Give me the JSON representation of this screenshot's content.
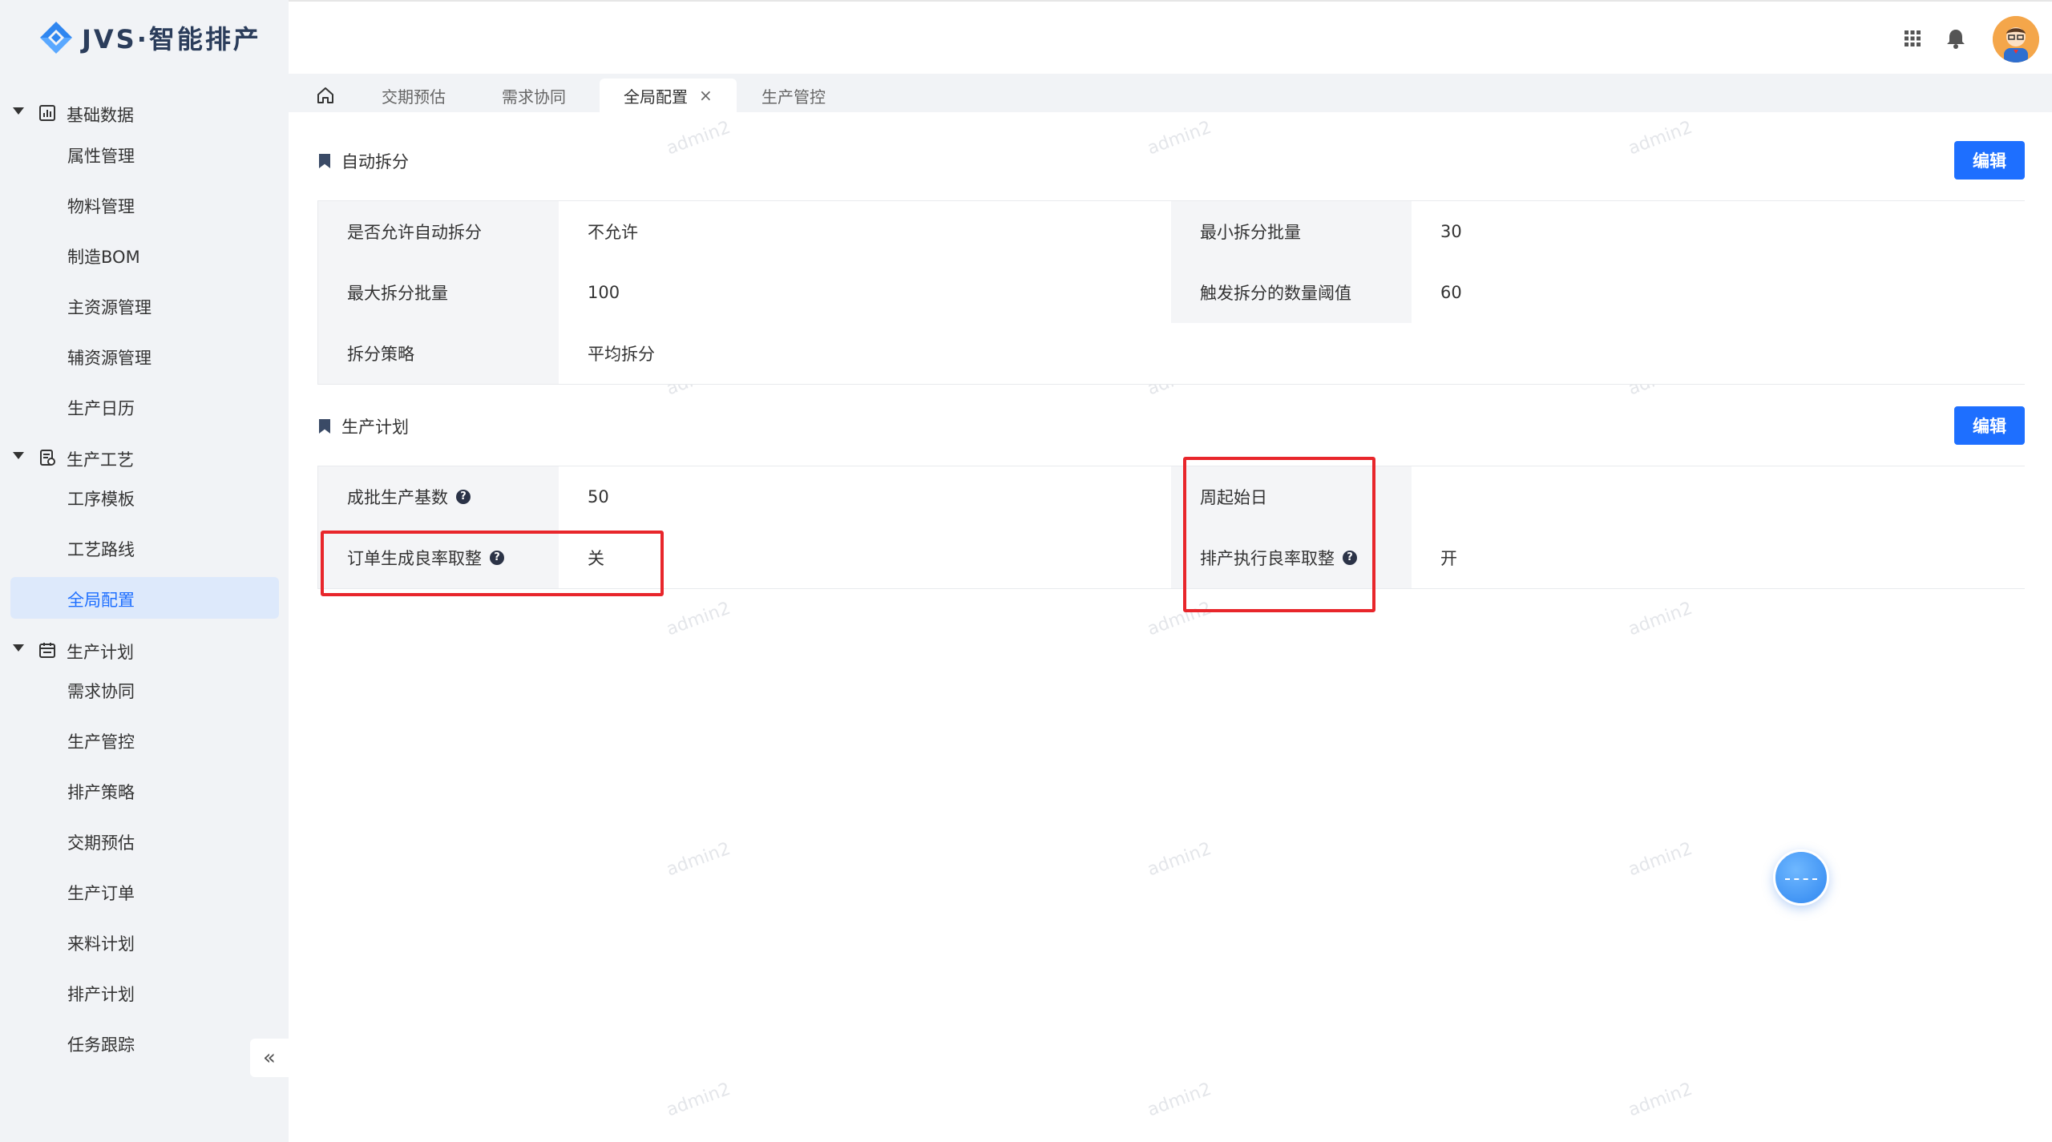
{
  "app": {
    "brand": "JVS·智能排产"
  },
  "sidebar": {
    "groups": [
      {
        "label": "基础数据",
        "items": [
          "属性管理",
          "物料管理",
          "制造BOM",
          "主资源管理",
          "辅资源管理",
          "生产日历"
        ]
      },
      {
        "label": "生产工艺",
        "items": [
          "工序模板",
          "工艺路线",
          "全局配置"
        ]
      },
      {
        "label": "生产计划",
        "items": [
          "需求协同",
          "生产管控",
          "排产策略",
          "交期预估",
          "生产订单",
          "来料计划",
          "排产计划",
          "任务跟踪"
        ]
      }
    ],
    "active_item": "全局配置",
    "collapse_glyph": "«"
  },
  "header": {
    "icons": [
      "apps-grid-icon",
      "bell-icon",
      "user-avatar"
    ]
  },
  "tabs": [
    {
      "label": "交期预估"
    },
    {
      "label": "需求协同"
    },
    {
      "label": "全局配置",
      "active": true,
      "close": "×"
    },
    {
      "label": "生产管控"
    }
  ],
  "sections": {
    "auto_split": {
      "title": "自动拆分",
      "edit_label": "编辑",
      "rows": [
        {
          "l1": "是否允许自动拆分",
          "v1": "不允许",
          "l2": "最小拆分批量",
          "v2": "30"
        },
        {
          "l1": "最大拆分批量",
          "v1": "100",
          "l2": "触发拆分的数量阈值",
          "v2": "60"
        },
        {
          "l1": "拆分策略",
          "v1": "平均拆分"
        }
      ]
    },
    "production_plan": {
      "title": "生产计划",
      "edit_label": "编辑",
      "rows": [
        {
          "l1": "成批生产基数",
          "v1": "50",
          "l2": "周起始日",
          "v2": ""
        },
        {
          "l1": "订单生成良率取整",
          "v1": "关",
          "l2": "排产执行良率取整",
          "v2": "开"
        }
      ],
      "help_glyph": "?"
    }
  },
  "watermark": "admin2",
  "colors": {
    "primary": "#1e6fff",
    "highlight": "#e8262b",
    "sidebar_bg": "#f1f3f6"
  }
}
